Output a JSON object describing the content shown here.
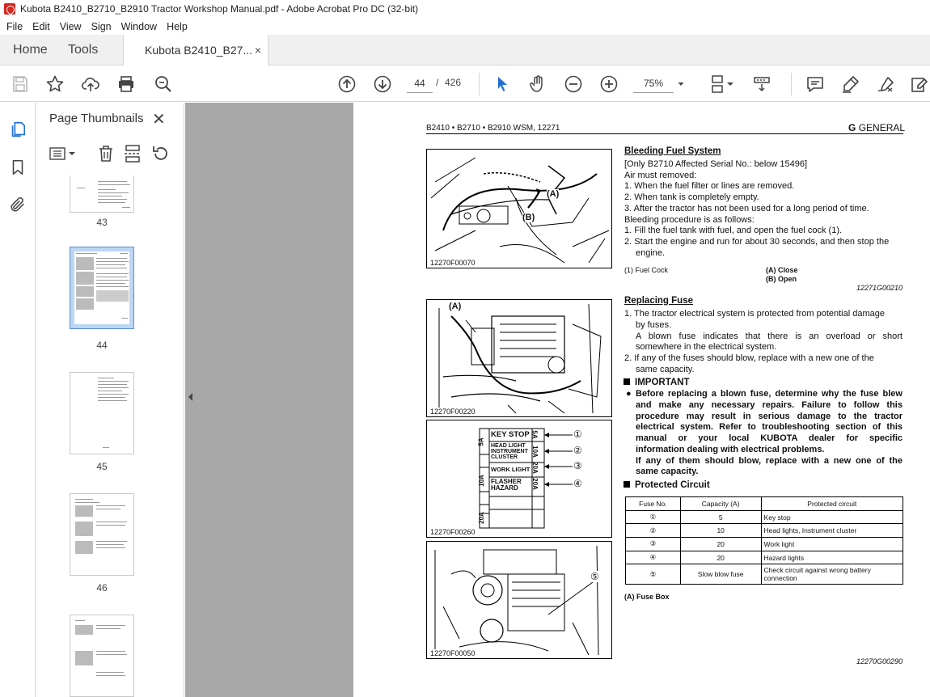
{
  "window": {
    "title": "Kubota B2410_B2710_B2910 Tractor Workshop Manual.pdf - Adobe Acrobat Pro DC (32-bit)"
  },
  "menu": [
    "File",
    "Edit",
    "View",
    "Sign",
    "Window",
    "Help"
  ],
  "tabs": {
    "home": "Home",
    "tools": "Tools",
    "document": "Kubota B2410_B27...",
    "close_symbol": "×"
  },
  "toolbar": {
    "page_current": "44",
    "page_separator": "/",
    "page_total": "426",
    "zoom": "75%"
  },
  "thumbnails": {
    "title": "Page Thumbnails",
    "close_symbol": "✕",
    "pages": [
      {
        "label": "43",
        "selected": false
      },
      {
        "label": "44",
        "selected": true
      },
      {
        "label": "45",
        "selected": false
      },
      {
        "label": "46",
        "selected": false
      },
      {
        "label": "",
        "selected": false
      }
    ]
  },
  "page": {
    "header_left": "B2410 • B2710 • B2910 WSM, 12271",
    "header_right_letter": "G",
    "header_right_word": "GENERAL",
    "fig1_caption": "12270F00070",
    "fig2_caption": "12270F00220",
    "fig3_caption": "12270F00260",
    "fig4_caption": "12270F00050",
    "fig1_label_a": "(A)",
    "fig1_label_b": "(B)",
    "fig2_label_a": "(A)",
    "fig4_label_5": "⑤",
    "fusebox": {
      "rows": [
        "KEY STOP",
        "HEAD LIGHT",
        "INSTRUMENT",
        "CLUSTER",
        "WORK LIGHT",
        "FLASHER",
        "HAZARD"
      ],
      "left_amps": [
        "5A",
        "10A",
        "20A"
      ],
      "right_amps": [
        "5A",
        "10A",
        "20A",
        "20A"
      ],
      "callouts": [
        "①",
        "②",
        "③",
        "④"
      ]
    },
    "bleeding": {
      "title": "Bleeding Fuel System",
      "lines": [
        "[Only B2710 Affected Serial No.: below 15496]",
        "Air must removed:",
        "1. When the fuel filter or lines are removed.",
        "2. When tank is completely empty.",
        "3. After the tractor has not been used for a long period of time.",
        "Bleeding procedure is as follows:",
        "1. Fill the fuel tank with fuel, and open the fuel cock (1).",
        "2. Start the engine and run for about 30 seconds, and then stop the",
        "engine."
      ],
      "legend_1": "(1)   Fuel Cock",
      "legend_a": "(A)   Close",
      "legend_b": "(B)   Open",
      "code": "12271G00210"
    },
    "fuse": {
      "title": "Replacing Fuse",
      "lines": [
        "1. The tractor electrical system is protected from potential damage",
        "by fuses.",
        "A blown fuse indicates that there is an overload or short",
        "somewhere in the electrical system.",
        "2. If any of the fuses should blow, replace with a new one of the",
        "same capacity."
      ],
      "important_head": "IMPORTANT",
      "important_lines": [
        "Before replacing a blown fuse, determine why the fuse blew",
        "and make any necessary repairs.  Failure to follow this",
        "procedure may result in serious damage to the tractor",
        "electrical system.  Refer to troubleshooting section of this",
        "manual or your local KUBOTA dealer for specific",
        "information dealing with electrical problems.",
        "If any of them should blow, replace with a new one of the",
        "same capacity."
      ],
      "protected_head": "Protected Circuit",
      "table": {
        "headers": [
          "Fuse No.",
          "Capacity (A)",
          "Protected circuit"
        ],
        "rows": [
          [
            "①",
            "5",
            "Key stop"
          ],
          [
            "②",
            "10",
            "Head lights, Instrument cluster"
          ],
          [
            "③",
            "20",
            "Work light"
          ],
          [
            "④",
            "20",
            "Hazard lights"
          ],
          [
            "⑤",
            "Slow blow fuse",
            "Check circuit against wrong battery connection"
          ]
        ]
      },
      "legend_a": "(A)   Fuse Box",
      "code": "12270G00290"
    }
  }
}
